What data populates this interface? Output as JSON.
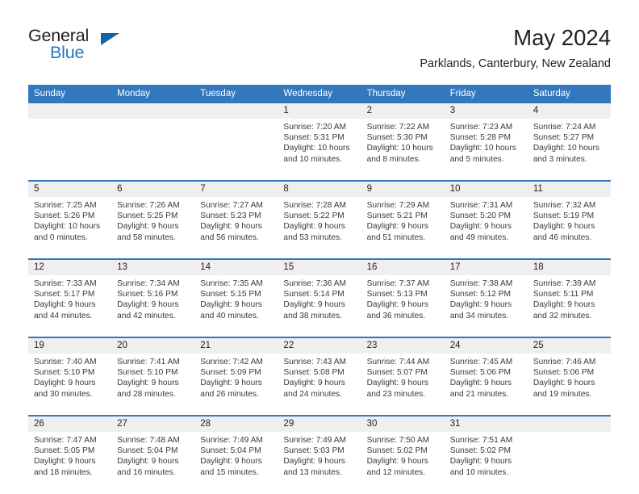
{
  "brand": {
    "name_part1": "General",
    "name_part2": "Blue",
    "accent_color": "#2378c1",
    "triangle_color": "#1464a5"
  },
  "header": {
    "title": "May 2024",
    "subtitle": "Parklands, Canterbury, New Zealand"
  },
  "theme": {
    "header_bg": "#3378bd",
    "header_text": "#ffffff",
    "daynum_band_bg": "#efefef",
    "cell_bg": "#ffffff",
    "separator": "#3378bd",
    "body_text": "#3a3a3a"
  },
  "weekday_headers": [
    "Sunday",
    "Monday",
    "Tuesday",
    "Wednesday",
    "Thursday",
    "Friday",
    "Saturday"
  ],
  "weeks": [
    {
      "days": [
        {
          "number": "",
          "sunrise": "",
          "sunset": "",
          "daylight_line1": "",
          "daylight_line2": ""
        },
        {
          "number": "",
          "sunrise": "",
          "sunset": "",
          "daylight_line1": "",
          "daylight_line2": ""
        },
        {
          "number": "",
          "sunrise": "",
          "sunset": "",
          "daylight_line1": "",
          "daylight_line2": ""
        },
        {
          "number": "1",
          "sunrise": "Sunrise: 7:20 AM",
          "sunset": "Sunset: 5:31 PM",
          "daylight_line1": "Daylight: 10 hours",
          "daylight_line2": "and 10 minutes."
        },
        {
          "number": "2",
          "sunrise": "Sunrise: 7:22 AM",
          "sunset": "Sunset: 5:30 PM",
          "daylight_line1": "Daylight: 10 hours",
          "daylight_line2": "and 8 minutes."
        },
        {
          "number": "3",
          "sunrise": "Sunrise: 7:23 AM",
          "sunset": "Sunset: 5:28 PM",
          "daylight_line1": "Daylight: 10 hours",
          "daylight_line2": "and 5 minutes."
        },
        {
          "number": "4",
          "sunrise": "Sunrise: 7:24 AM",
          "sunset": "Sunset: 5:27 PM",
          "daylight_line1": "Daylight: 10 hours",
          "daylight_line2": "and 3 minutes."
        }
      ]
    },
    {
      "days": [
        {
          "number": "5",
          "sunrise": "Sunrise: 7:25 AM",
          "sunset": "Sunset: 5:26 PM",
          "daylight_line1": "Daylight: 10 hours",
          "daylight_line2": "and 0 minutes."
        },
        {
          "number": "6",
          "sunrise": "Sunrise: 7:26 AM",
          "sunset": "Sunset: 5:25 PM",
          "daylight_line1": "Daylight: 9 hours",
          "daylight_line2": "and 58 minutes."
        },
        {
          "number": "7",
          "sunrise": "Sunrise: 7:27 AM",
          "sunset": "Sunset: 5:23 PM",
          "daylight_line1": "Daylight: 9 hours",
          "daylight_line2": "and 56 minutes."
        },
        {
          "number": "8",
          "sunrise": "Sunrise: 7:28 AM",
          "sunset": "Sunset: 5:22 PM",
          "daylight_line1": "Daylight: 9 hours",
          "daylight_line2": "and 53 minutes."
        },
        {
          "number": "9",
          "sunrise": "Sunrise: 7:29 AM",
          "sunset": "Sunset: 5:21 PM",
          "daylight_line1": "Daylight: 9 hours",
          "daylight_line2": "and 51 minutes."
        },
        {
          "number": "10",
          "sunrise": "Sunrise: 7:31 AM",
          "sunset": "Sunset: 5:20 PM",
          "daylight_line1": "Daylight: 9 hours",
          "daylight_line2": "and 49 minutes."
        },
        {
          "number": "11",
          "sunrise": "Sunrise: 7:32 AM",
          "sunset": "Sunset: 5:19 PM",
          "daylight_line1": "Daylight: 9 hours",
          "daylight_line2": "and 46 minutes."
        }
      ]
    },
    {
      "days": [
        {
          "number": "12",
          "sunrise": "Sunrise: 7:33 AM",
          "sunset": "Sunset: 5:17 PM",
          "daylight_line1": "Daylight: 9 hours",
          "daylight_line2": "and 44 minutes."
        },
        {
          "number": "13",
          "sunrise": "Sunrise: 7:34 AM",
          "sunset": "Sunset: 5:16 PM",
          "daylight_line1": "Daylight: 9 hours",
          "daylight_line2": "and 42 minutes."
        },
        {
          "number": "14",
          "sunrise": "Sunrise: 7:35 AM",
          "sunset": "Sunset: 5:15 PM",
          "daylight_line1": "Daylight: 9 hours",
          "daylight_line2": "and 40 minutes."
        },
        {
          "number": "15",
          "sunrise": "Sunrise: 7:36 AM",
          "sunset": "Sunset: 5:14 PM",
          "daylight_line1": "Daylight: 9 hours",
          "daylight_line2": "and 38 minutes."
        },
        {
          "number": "16",
          "sunrise": "Sunrise: 7:37 AM",
          "sunset": "Sunset: 5:13 PM",
          "daylight_line1": "Daylight: 9 hours",
          "daylight_line2": "and 36 minutes."
        },
        {
          "number": "17",
          "sunrise": "Sunrise: 7:38 AM",
          "sunset": "Sunset: 5:12 PM",
          "daylight_line1": "Daylight: 9 hours",
          "daylight_line2": "and 34 minutes."
        },
        {
          "number": "18",
          "sunrise": "Sunrise: 7:39 AM",
          "sunset": "Sunset: 5:11 PM",
          "daylight_line1": "Daylight: 9 hours",
          "daylight_line2": "and 32 minutes."
        }
      ]
    },
    {
      "days": [
        {
          "number": "19",
          "sunrise": "Sunrise: 7:40 AM",
          "sunset": "Sunset: 5:10 PM",
          "daylight_line1": "Daylight: 9 hours",
          "daylight_line2": "and 30 minutes."
        },
        {
          "number": "20",
          "sunrise": "Sunrise: 7:41 AM",
          "sunset": "Sunset: 5:10 PM",
          "daylight_line1": "Daylight: 9 hours",
          "daylight_line2": "and 28 minutes."
        },
        {
          "number": "21",
          "sunrise": "Sunrise: 7:42 AM",
          "sunset": "Sunset: 5:09 PM",
          "daylight_line1": "Daylight: 9 hours",
          "daylight_line2": "and 26 minutes."
        },
        {
          "number": "22",
          "sunrise": "Sunrise: 7:43 AM",
          "sunset": "Sunset: 5:08 PM",
          "daylight_line1": "Daylight: 9 hours",
          "daylight_line2": "and 24 minutes."
        },
        {
          "number": "23",
          "sunrise": "Sunrise: 7:44 AM",
          "sunset": "Sunset: 5:07 PM",
          "daylight_line1": "Daylight: 9 hours",
          "daylight_line2": "and 23 minutes."
        },
        {
          "number": "24",
          "sunrise": "Sunrise: 7:45 AM",
          "sunset": "Sunset: 5:06 PM",
          "daylight_line1": "Daylight: 9 hours",
          "daylight_line2": "and 21 minutes."
        },
        {
          "number": "25",
          "sunrise": "Sunrise: 7:46 AM",
          "sunset": "Sunset: 5:06 PM",
          "daylight_line1": "Daylight: 9 hours",
          "daylight_line2": "and 19 minutes."
        }
      ]
    },
    {
      "days": [
        {
          "number": "26",
          "sunrise": "Sunrise: 7:47 AM",
          "sunset": "Sunset: 5:05 PM",
          "daylight_line1": "Daylight: 9 hours",
          "daylight_line2": "and 18 minutes."
        },
        {
          "number": "27",
          "sunrise": "Sunrise: 7:48 AM",
          "sunset": "Sunset: 5:04 PM",
          "daylight_line1": "Daylight: 9 hours",
          "daylight_line2": "and 16 minutes."
        },
        {
          "number": "28",
          "sunrise": "Sunrise: 7:49 AM",
          "sunset": "Sunset: 5:04 PM",
          "daylight_line1": "Daylight: 9 hours",
          "daylight_line2": "and 15 minutes."
        },
        {
          "number": "29",
          "sunrise": "Sunrise: 7:49 AM",
          "sunset": "Sunset: 5:03 PM",
          "daylight_line1": "Daylight: 9 hours",
          "daylight_line2": "and 13 minutes."
        },
        {
          "number": "30",
          "sunrise": "Sunrise: 7:50 AM",
          "sunset": "Sunset: 5:02 PM",
          "daylight_line1": "Daylight: 9 hours",
          "daylight_line2": "and 12 minutes."
        },
        {
          "number": "31",
          "sunrise": "Sunrise: 7:51 AM",
          "sunset": "Sunset: 5:02 PM",
          "daylight_line1": "Daylight: 9 hours",
          "daylight_line2": "and 10 minutes."
        },
        {
          "number": "",
          "sunrise": "",
          "sunset": "",
          "daylight_line1": "",
          "daylight_line2": ""
        }
      ]
    }
  ]
}
